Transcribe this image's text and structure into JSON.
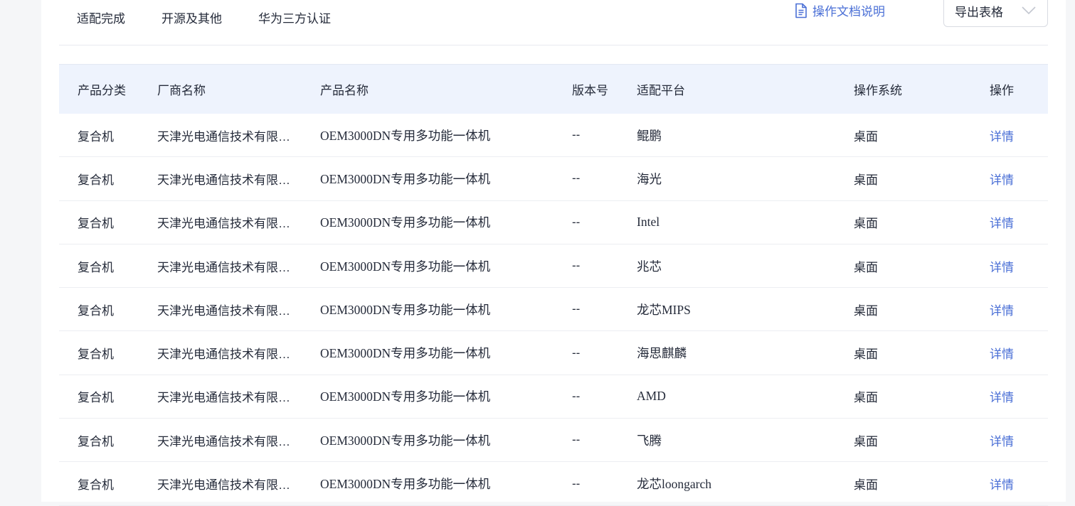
{
  "tabs": [
    "适配完成",
    "开源及其他",
    "华为三方认证"
  ],
  "doc_link": {
    "label": "操作文档说明",
    "icon": "document-icon"
  },
  "export": {
    "label": "导出表格",
    "icon": "chevron-down-icon"
  },
  "colors": {
    "accent": "#4a6fd6",
    "header_bg": "#eef3fd"
  },
  "table": {
    "headers": [
      "产品分类",
      "厂商名称",
      "产品名称",
      "版本号",
      "适配平台",
      "操作系统",
      "操作"
    ],
    "rows": [
      [
        "复合机",
        "天津光电通信技术有限公司",
        "OEM3000DN专用多功能一体机",
        "--",
        "鲲鹏",
        "桌面",
        "详情"
      ],
      [
        "复合机",
        "天津光电通信技术有限公司",
        "OEM3000DN专用多功能一体机",
        "--",
        "海光",
        "桌面",
        "详情"
      ],
      [
        "复合机",
        "天津光电通信技术有限公司",
        "OEM3000DN专用多功能一体机",
        "--",
        "Intel",
        "桌面",
        "详情"
      ],
      [
        "复合机",
        "天津光电通信技术有限公司",
        "OEM3000DN专用多功能一体机",
        "--",
        "兆芯",
        "桌面",
        "详情"
      ],
      [
        "复合机",
        "天津光电通信技术有限公司",
        "OEM3000DN专用多功能一体机",
        "--",
        "龙芯MIPS",
        "桌面",
        "详情"
      ],
      [
        "复合机",
        "天津光电通信技术有限公司",
        "OEM3000DN专用多功能一体机",
        "--",
        "海思麒麟",
        "桌面",
        "详情"
      ],
      [
        "复合机",
        "天津光电通信技术有限公司",
        "OEM3000DN专用多功能一体机",
        "--",
        "AMD",
        "桌面",
        "详情"
      ],
      [
        "复合机",
        "天津光电通信技术有限公司",
        "OEM3000DN专用多功能一体机",
        "--",
        "飞腾",
        "桌面",
        "详情"
      ],
      [
        "复合机",
        "天津光电通信技术有限公司",
        "OEM3000DN专用多功能一体机",
        "--",
        "龙芯loongarch",
        "桌面",
        "详情"
      ]
    ]
  }
}
